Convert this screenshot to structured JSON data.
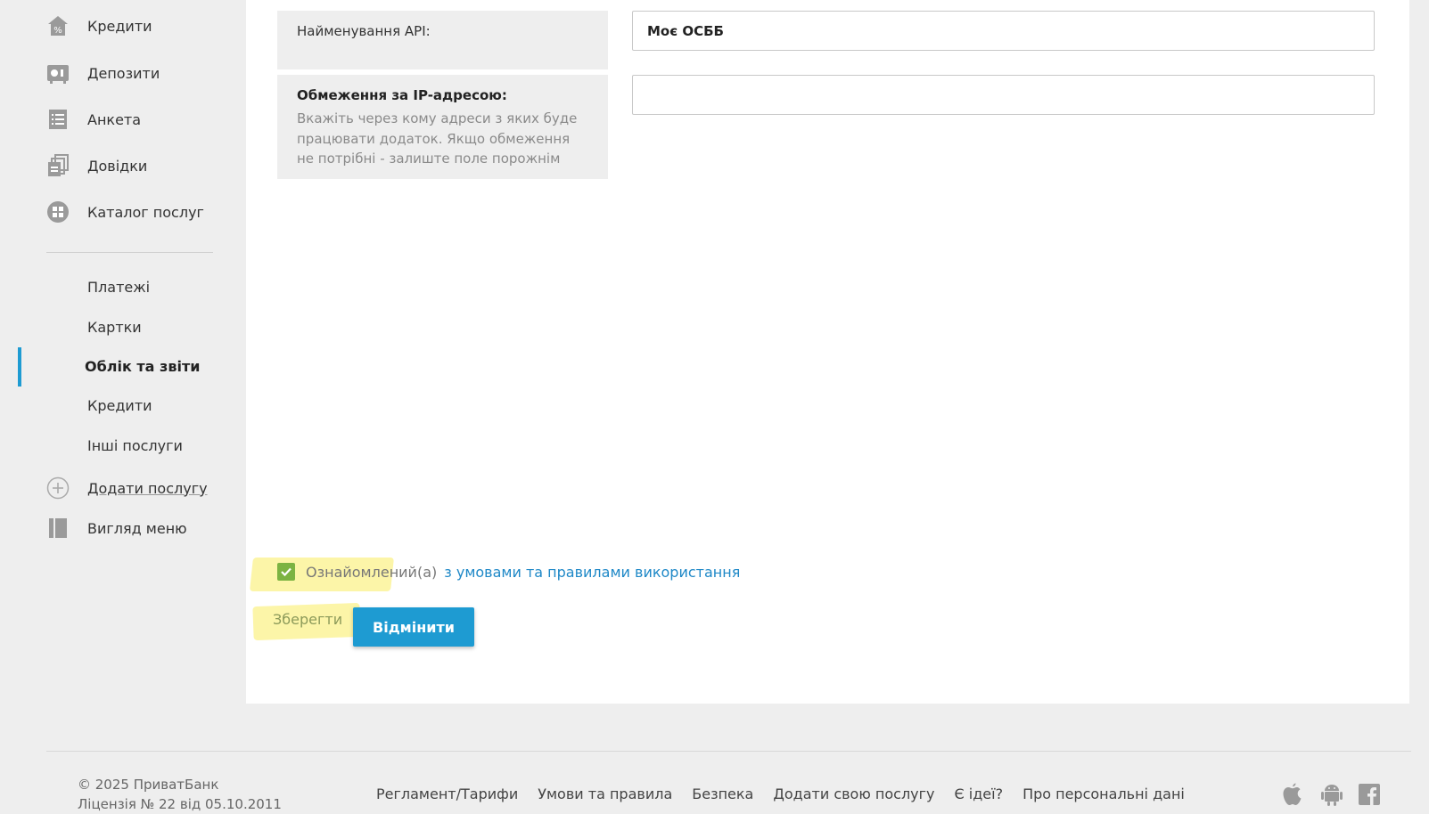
{
  "sidebar": {
    "main_items": [
      {
        "label": "Кредити",
        "icon": "house-percent-icon"
      },
      {
        "label": "Депозити",
        "icon": "deposit-icon"
      },
      {
        "label": "Анкета",
        "icon": "form-list-icon"
      },
      {
        "label": "Довідки",
        "icon": "documents-icon"
      },
      {
        "label": "Каталог послуг",
        "icon": "grid-catalog-icon"
      }
    ],
    "sub_items": [
      {
        "label": "Платежі",
        "active": false
      },
      {
        "label": "Картки",
        "active": false
      },
      {
        "label": "Облік та звіти",
        "active": true
      },
      {
        "label": "Кредити",
        "active": false
      },
      {
        "label": "Інші послуги",
        "active": false
      }
    ],
    "add_service": {
      "label": "Додати послугу",
      "icon": "plus-circle-icon"
    },
    "menu_view": {
      "label": "Вигляд меню",
      "icon": "menu-layout-icon"
    }
  },
  "form": {
    "api_name": {
      "label": "Найменування API:",
      "value": "Моє ОСББ"
    },
    "ip_restriction": {
      "label": "Обмеження за IP-адресою:",
      "description_lines": [
        "Вкажіть через кому адреси з яких буде",
        "працювати додаток. Якщо обмеження",
        "не потрібні - залиште поле порожнім"
      ],
      "value": ""
    },
    "agree": {
      "checked": true,
      "text": "Ознайомлений(а)",
      "link_text": "з умовами та правилами використання"
    },
    "save_label": "Зберегти",
    "cancel_label": "Відмінити"
  },
  "footer": {
    "copyright": "© 2025 ПриватБанк",
    "license": "Ліцензія № 22 від 05.10.2011",
    "links": [
      "Регламент/Тарифи",
      "Умови та правила",
      "Безпека",
      "Додати свою послугу",
      "Є ідеї?",
      "Про персональні дані"
    ],
    "social_icons": [
      "apple-icon",
      "android-icon",
      "facebook-icon"
    ]
  },
  "colors": {
    "accent": "#1e9bd2",
    "link": "#1e88c7",
    "check": "#7cb342",
    "highlight": "#faee6e"
  }
}
